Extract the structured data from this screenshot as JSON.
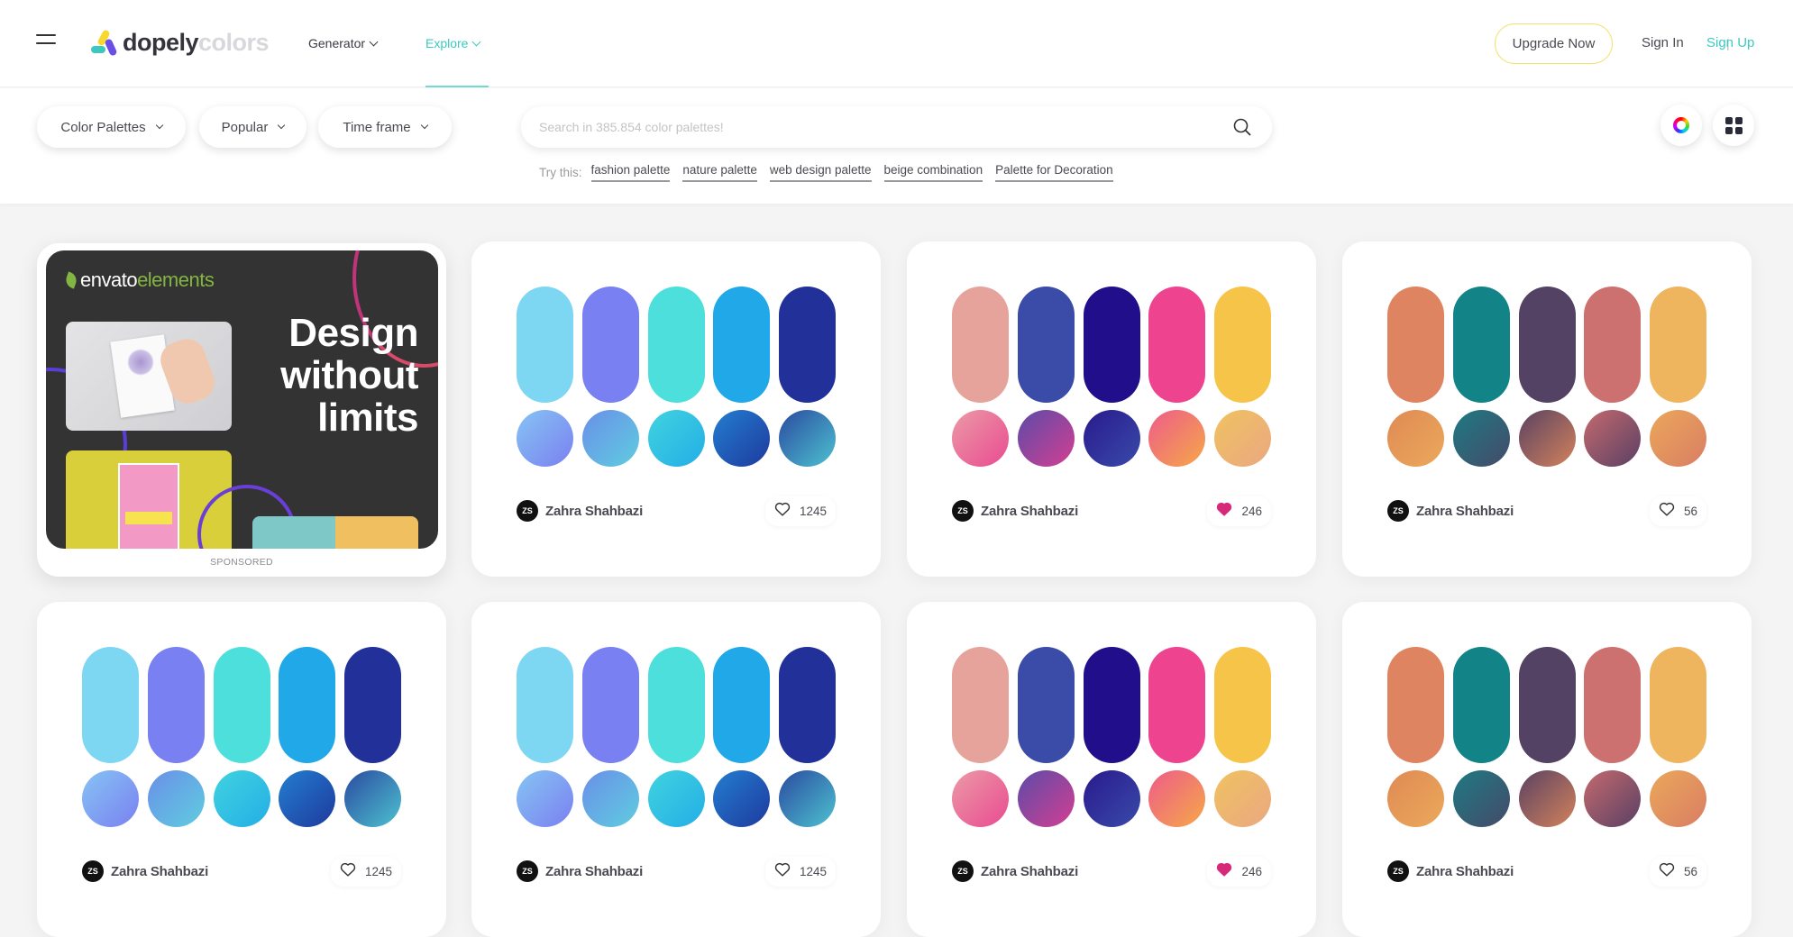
{
  "header": {
    "logo_dark": "dopely",
    "logo_light": "colors",
    "nav": [
      {
        "label": "Generator",
        "active": false
      },
      {
        "label": "Explore",
        "active": true
      }
    ],
    "upgrade_label": "Upgrade Now",
    "signin_label": "Sign In",
    "separator": "|",
    "signup_label": "Sign Up"
  },
  "colors": {
    "accent": "#3ccac0",
    "upgrade_border": "#f2e26a",
    "liked_heart": "#d6297a"
  },
  "filters": {
    "pills": [
      {
        "label": "Color Palettes"
      },
      {
        "label": "Popular"
      },
      {
        "label": "Time frame"
      }
    ],
    "search_placeholder": "Search in 385.854 color palettes!",
    "search_value": "",
    "try_label": "Try this:",
    "suggestions": [
      "fashion palette",
      "nature palette",
      "web design palette",
      "beige combination",
      "Palette for Decoration"
    ],
    "icons": [
      "color-wheel-icon",
      "grid-view-icon"
    ]
  },
  "ad": {
    "brand_main": "envato",
    "brand_sub": "elements",
    "headline_1": "Design",
    "headline_2": "without",
    "headline_3": "limits",
    "sponsored_label": "SPONSORED"
  },
  "palettes": [
    {
      "author_initials": "ZS",
      "author": "Zahra Shahbazi",
      "likes": "1245",
      "liked": false,
      "colors": [
        "#7dd6f2",
        "#7880f2",
        "#4ddfdc",
        "#21a8e8",
        "#22309a"
      ],
      "gradients": [
        [
          "#86c4f4",
          "#7a80f0"
        ],
        [
          "#6a8fe8",
          "#5fcde0"
        ],
        [
          "#40d3e0",
          "#24aee6"
        ],
        [
          "#237ed0",
          "#1e3a9e"
        ],
        [
          "#2a4aa0",
          "#4dc2d0"
        ]
      ]
    },
    {
      "author_initials": "ZS",
      "author": "Zahra Shahbazi",
      "likes": "246",
      "liked": true,
      "colors": [
        "#e6a39c",
        "#3b4ba8",
        "#200e8a",
        "#ee4490",
        "#f7c44a"
      ],
      "gradients": [
        [
          "#eb9aa6",
          "#ea4b91"
        ],
        [
          "#5b4ba8",
          "#d43f92"
        ],
        [
          "#281a8e",
          "#3a4aa8"
        ],
        [
          "#ee5b88",
          "#f5a84a"
        ],
        [
          "#f0c260",
          "#eaa882"
        ]
      ]
    },
    {
      "author_initials": "ZS",
      "author": "Zahra Shahbazi",
      "likes": "56",
      "liked": false,
      "colors": [
        "#df8460",
        "#128387",
        "#534264",
        "#cc7070",
        "#eeb45e"
      ],
      "gradients": [
        [
          "#e08a55",
          "#eaa95a"
        ],
        [
          "#1e7a82",
          "#454a6a"
        ],
        [
          "#5a4262",
          "#d4825c"
        ],
        [
          "#c46a6e",
          "#5a4064"
        ],
        [
          "#eaa85a",
          "#da7d64"
        ]
      ]
    },
    {
      "author_initials": "ZS",
      "author": "Zahra Shahbazi",
      "likes": "1245",
      "liked": false,
      "colors": [
        "#7dd6f2",
        "#7880f2",
        "#4ddfdc",
        "#21a8e8",
        "#22309a"
      ],
      "gradients": [
        [
          "#86c4f4",
          "#7a80f0"
        ],
        [
          "#6a8fe8",
          "#5fcde0"
        ],
        [
          "#40d3e0",
          "#24aee6"
        ],
        [
          "#237ed0",
          "#1e3a9e"
        ],
        [
          "#2a4aa0",
          "#4dc2d0"
        ]
      ]
    },
    {
      "author_initials": "ZS",
      "author": "Zahra Shahbazi",
      "likes": "1245",
      "liked": false,
      "colors": [
        "#7dd6f2",
        "#7880f2",
        "#4ddfdc",
        "#21a8e8",
        "#22309a"
      ],
      "gradients": [
        [
          "#86c4f4",
          "#7a80f0"
        ],
        [
          "#6a8fe8",
          "#5fcde0"
        ],
        [
          "#40d3e0",
          "#24aee6"
        ],
        [
          "#237ed0",
          "#1e3a9e"
        ],
        [
          "#2a4aa0",
          "#4dc2d0"
        ]
      ]
    },
    {
      "author_initials": "ZS",
      "author": "Zahra Shahbazi",
      "likes": "246",
      "liked": true,
      "colors": [
        "#e6a39c",
        "#3b4ba8",
        "#200e8a",
        "#ee4490",
        "#f7c44a"
      ],
      "gradients": [
        [
          "#eb9aa6",
          "#ea4b91"
        ],
        [
          "#5b4ba8",
          "#d43f92"
        ],
        [
          "#281a8e",
          "#3a4aa8"
        ],
        [
          "#ee5b88",
          "#f5a84a"
        ],
        [
          "#f0c260",
          "#eaa882"
        ]
      ]
    },
    {
      "author_initials": "ZS",
      "author": "Zahra Shahbazi",
      "likes": "56",
      "liked": false,
      "colors": [
        "#df8460",
        "#128387",
        "#534264",
        "#cc7070",
        "#eeb45e"
      ],
      "gradients": [
        [
          "#e08a55",
          "#eaa95a"
        ],
        [
          "#1e7a82",
          "#454a6a"
        ],
        [
          "#5a4262",
          "#d4825c"
        ],
        [
          "#c46a6e",
          "#5a4064"
        ],
        [
          "#eaa85a",
          "#da7d64"
        ]
      ]
    }
  ]
}
